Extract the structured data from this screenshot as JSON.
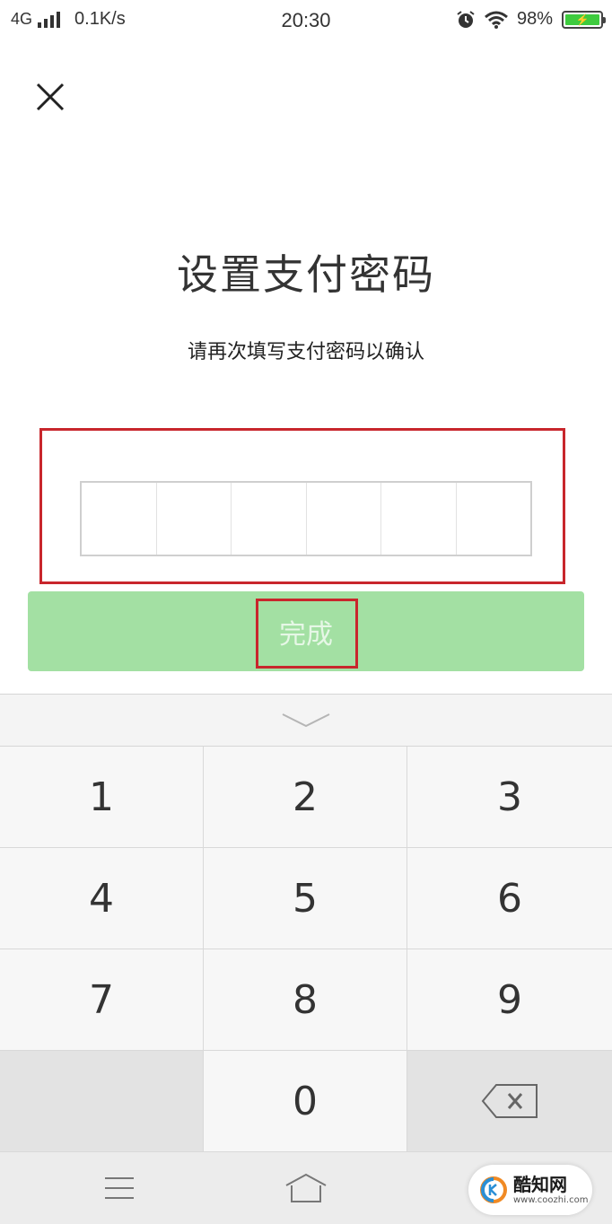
{
  "status_bar": {
    "network": "4G",
    "speed": "0.1K/s",
    "time": "20:30",
    "battery": "98%",
    "battery_color": "#3ecb3e"
  },
  "header": {
    "close_icon": "close-icon"
  },
  "title": "设置支付密码",
  "subtitle": "请再次填写支付密码以确认",
  "pin": {
    "length": 6,
    "filled": 0
  },
  "done_button": {
    "label": "完成",
    "color": "#a3e0a3",
    "enabled": false
  },
  "keyboard": {
    "collapse_icon": "chevron-down-icon",
    "keys": [
      "1",
      "2",
      "3",
      "4",
      "5",
      "6",
      "7",
      "8",
      "9",
      "",
      "0",
      "backspace"
    ]
  },
  "nav_bar": {
    "menu_icon": "menu-icon",
    "home_icon": "home-icon"
  },
  "watermark": {
    "name": "酷知网",
    "url": "www.coozhi.com"
  },
  "highlight_color": "#c8262c"
}
